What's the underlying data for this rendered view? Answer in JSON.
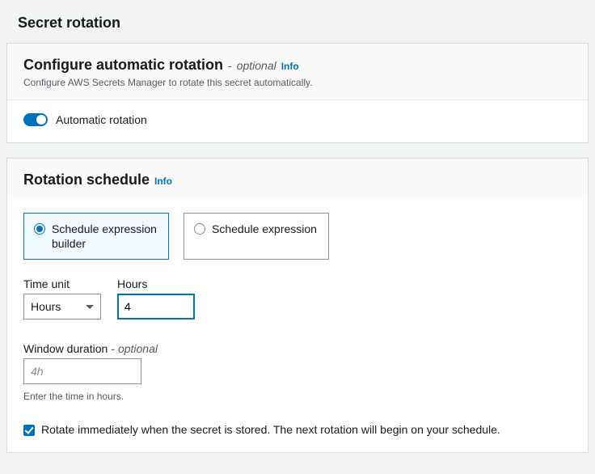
{
  "page_title": "Secret rotation",
  "config_panel": {
    "title": "Configure automatic rotation",
    "optional": "optional",
    "info": "Info",
    "desc": "Configure AWS Secrets Manager to rotate this secret automatically.",
    "toggle_label": "Automatic rotation",
    "toggle_on": true
  },
  "schedule_panel": {
    "title": "Rotation schedule",
    "info": "Info",
    "tiles": {
      "builder": "Schedule expression builder",
      "expression": "Schedule expression"
    },
    "time_unit_label": "Time unit",
    "time_unit_value": "Hours",
    "hours_label": "Hours",
    "hours_value": "4",
    "window_label": "Window duration",
    "window_optional": "optional",
    "window_placeholder": "4h",
    "window_helper": "Enter the time in hours.",
    "rotate_now": "Rotate immediately when the secret is stored. The next rotation will begin on your schedule."
  }
}
